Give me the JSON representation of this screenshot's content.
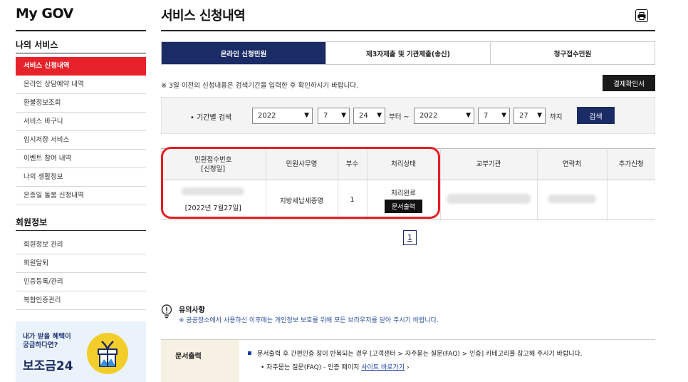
{
  "sidebar": {
    "brand": "My GOV",
    "my_services_title": "나의 서비스",
    "my_services": [
      {
        "label": "서비스 신청내역",
        "active": true
      },
      {
        "label": "온라인 상담예약 내역"
      },
      {
        "label": "환불정보조회"
      },
      {
        "label": "서비스 바구니"
      },
      {
        "label": "임시저장 서비스"
      },
      {
        "label": "이벤트 참여 내역"
      },
      {
        "label": "나의 생활정보"
      },
      {
        "label": "온종일 돌봄 신청내역"
      }
    ],
    "member_title": "회원정보",
    "member_items": [
      {
        "label": "회원정보 관리"
      },
      {
        "label": "회원탈퇴"
      },
      {
        "label": "인증등록/관리"
      },
      {
        "label": "복합인증관리"
      }
    ],
    "banner": {
      "line1": "내가 받을 혜택이",
      "line2": "궁금하다면?",
      "big": "보조금24"
    }
  },
  "main": {
    "title": "서비스 신청내역",
    "tabs": [
      {
        "label": "온라인 신청민원",
        "active": true
      },
      {
        "label": "제3자제출 및 기관제출(송신)"
      },
      {
        "label": "청구접수민원"
      }
    ],
    "notice": "※ 3일 이전의 신청내용은 검색기간을 입력한 후 확인하시기 바랍니다.",
    "receipt_button": "결제확인서",
    "search": {
      "label": "• 기간별 검색",
      "from_year": "2022",
      "from_month": "7",
      "from_day": "24",
      "from_suffix": "부터 ~",
      "to_year": "2022",
      "to_month": "7",
      "to_day": "27",
      "to_suffix": "까지",
      "button": "검색"
    },
    "table": {
      "headers": [
        "민원접수번호\n[신청일]",
        "민원사무명",
        "부수",
        "처리상태",
        "교부기관",
        "연락처",
        "추가신청"
      ],
      "row": {
        "receipt_date": "[2022년 7월27일]",
        "service_name": "지방세납세증명",
        "copies": "1",
        "status": "처리완료",
        "status_button": "문서출력"
      }
    },
    "pagination": {
      "current": "1"
    },
    "caution": {
      "title": "유의사항",
      "text": "※ 공공장소에서 사용하신 이후에는 개인정보 보호를 위해 모든 브라우저를 닫아 주시기 바랍니다."
    },
    "info": {
      "label": "문서출력",
      "line1": "문서출력 후 간편인증 창이 반복되는 경우 [고객센터 > 자주묻는 질문(FAQ) > 인증] 카테고리를 참고해 주시기 바랍니다.",
      "line2_prefix": "• 자주묻는 질문(FAQ) - 인증 페이지",
      "line2_link": "사이트 바로가기",
      "line2_arrow": "›"
    }
  },
  "colors": {
    "accent_red": "#e8222a",
    "navy": "#1b2b66",
    "highlight": "#e41e24"
  }
}
